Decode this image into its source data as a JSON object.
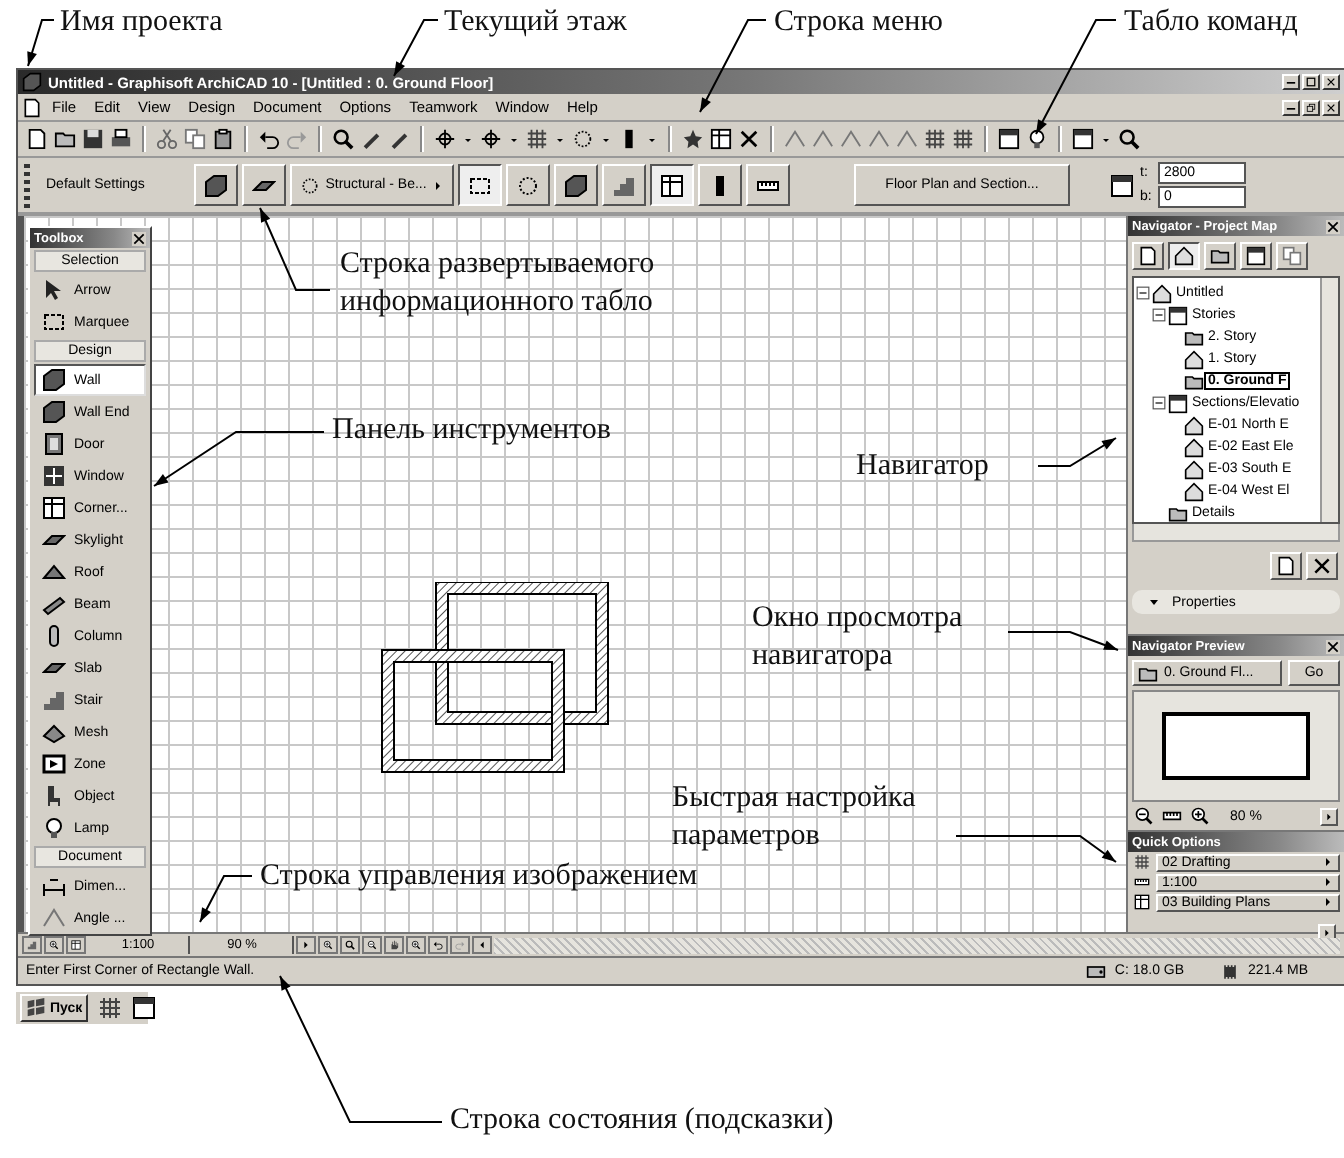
{
  "annotations": [
    "Имя проекта",
    "Текущий этаж",
    "Строка меню",
    "Табло команд",
    "Строка развертываемого информационного табло",
    "Панель инструментов",
    "Навигатор",
    "Окно просмотра навигатора",
    "Быстрая настройка параметров",
    "Строка управления изображением",
    "Строка состояния (подсказки)"
  ],
  "window": {
    "title": "Untitled - Graphisoft ArchiCAD 10 - [Untitled : 0. Ground Floor]"
  },
  "menu": [
    "File",
    "Edit",
    "View",
    "Design",
    "Document",
    "Options",
    "Teamwork",
    "Window",
    "Help"
  ],
  "info_box": {
    "settings": "Default Settings",
    "layer": "Structural - Be...",
    "view_button": "Floor Plan and Section...",
    "top_label": "t:",
    "top_value": "2800",
    "bottom_label": "b:",
    "bottom_value": "0"
  },
  "toolbox": {
    "title": "Toolbox",
    "sections": [
      {
        "title": "Selection",
        "tools": [
          {
            "label": "Arrow",
            "selected": false
          },
          {
            "label": "Marquee",
            "selected": false
          }
        ]
      },
      {
        "title": "Design",
        "tools": [
          {
            "label": "Wall",
            "selected": true
          },
          {
            "label": "Wall End",
            "selected": false
          },
          {
            "label": "Door",
            "selected": false
          },
          {
            "label": "Window",
            "selected": false
          },
          {
            "label": "Corner...",
            "selected": false
          },
          {
            "label": "Skylight",
            "selected": false
          },
          {
            "label": "Roof",
            "selected": false
          },
          {
            "label": "Beam",
            "selected": false
          },
          {
            "label": "Column",
            "selected": false
          },
          {
            "label": "Slab",
            "selected": false
          },
          {
            "label": "Stair",
            "selected": false
          },
          {
            "label": "Mesh",
            "selected": false
          },
          {
            "label": "Zone",
            "selected": false
          },
          {
            "label": "Object",
            "selected": false
          },
          {
            "label": "Lamp",
            "selected": false
          }
        ]
      },
      {
        "title": "Document",
        "tools": [
          {
            "label": "Dimen...",
            "selected": false
          },
          {
            "label": "Angle ...",
            "selected": false
          }
        ]
      }
    ]
  },
  "navigator": {
    "title": "Navigator - Project Map",
    "tree": [
      {
        "label": "Untitled",
        "expanded": true,
        "selected": false,
        "children": [
          {
            "label": "Stories",
            "expanded": true,
            "selected": false,
            "children": [
              {
                "label": "2. Story",
                "selected": false
              },
              {
                "label": "1. Story",
                "selected": false
              },
              {
                "label": "0. Ground F",
                "selected": true
              }
            ]
          },
          {
            "label": "Sections/Elevatio",
            "expanded": true,
            "selected": false,
            "children": [
              {
                "label": "E-01 North E",
                "selected": false
              },
              {
                "label": "E-02 East Ele",
                "selected": false
              },
              {
                "label": "E-03 South E",
                "selected": false
              },
              {
                "label": "E-04 West El",
                "selected": false
              }
            ]
          },
          {
            "label": "Details",
            "selected": false
          }
        ]
      }
    ],
    "properties": "Properties"
  },
  "navigator_preview": {
    "title": "Navigator Preview",
    "view": "0. Ground Fl...",
    "go": "Go",
    "zoom": "80 %"
  },
  "quick_options": {
    "title": "Quick Options",
    "rows": [
      "02 Drafting",
      "1:100",
      "03 Building Plans"
    ]
  },
  "view_bar": {
    "scale": "1:100",
    "zoom": "90 %"
  },
  "status_bar": {
    "hint": "Enter First Corner of Rectangle Wall.",
    "disk": "C: 18.0 GB",
    "memory": "221.4 MB"
  },
  "taskbar": {
    "start": "Пуск"
  }
}
